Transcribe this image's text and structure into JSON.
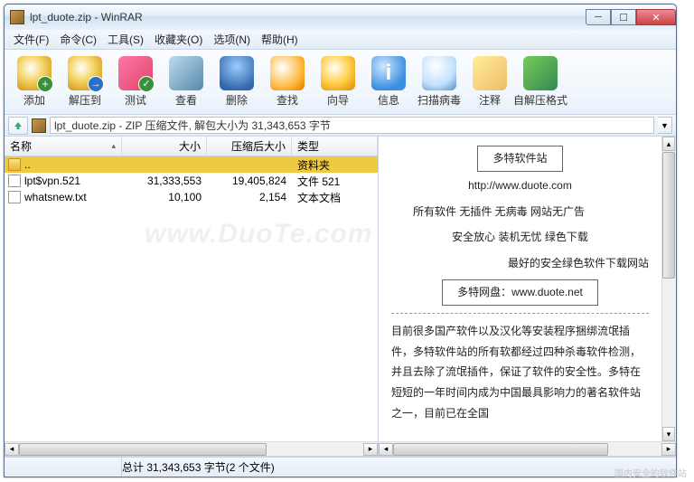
{
  "window": {
    "title": "lpt_duote.zip - WinRAR"
  },
  "menus": {
    "file": "文件(F)",
    "cmd": "命令(C)",
    "tools": "工具(S)",
    "fav": "收藏夹(O)",
    "opt": "选项(N)",
    "help": "帮助(H)"
  },
  "toolbar": {
    "add": "添加",
    "extract": "解压到",
    "test": "测试",
    "view": "查看",
    "delete": "删除",
    "find": "查找",
    "wizard": "向导",
    "info": "信息",
    "virus": "扫描病毒",
    "comment": "注释",
    "sfx": "自解压格式"
  },
  "pathbar": {
    "text": "lpt_duote.zip - ZIP 压缩文件, 解包大小为 31,343,653 字节"
  },
  "columns": {
    "name": "名称",
    "size": "大小",
    "compressed": "压缩后大小",
    "type": "类型"
  },
  "rows": [
    {
      "name": "..",
      "type": "资料夹",
      "icon": "folder",
      "sel": true
    },
    {
      "name": "lpt$vpn.521",
      "size": "31,333,553",
      "compressed": "19,405,824",
      "type": "文件 521",
      "icon": "file"
    },
    {
      "name": "whatsnew.txt",
      "size": "10,100",
      "compressed": "2,154",
      "type": "文本文档",
      "icon": "txt"
    }
  ],
  "preview": {
    "site_name": "多特软件站",
    "site_url": "http://www.duote.com",
    "line1": "所有软件  无插件  无病毒  网站无广告",
    "line2": "安全放心  装机无忧  绿色下载",
    "line3": "最好的安全绿色软件下载网站",
    "netdisk": "多特网盘：www.duote.net",
    "para": "目前很多国产软件以及汉化等安装程序捆绑流氓插件，多特软件站的所有软都经过四种杀毒软件检测，并且去除了流氓插件，保证了软件的安全性。多特在短短的一年时间内成为中国最具影响力的著名软件站之一，目前已在全国"
  },
  "status": {
    "text": "总计 31,343,653 字节(2 个文件)"
  },
  "watermark": "www.DuoTe.com",
  "corner_wm": "国内安全的软件站"
}
